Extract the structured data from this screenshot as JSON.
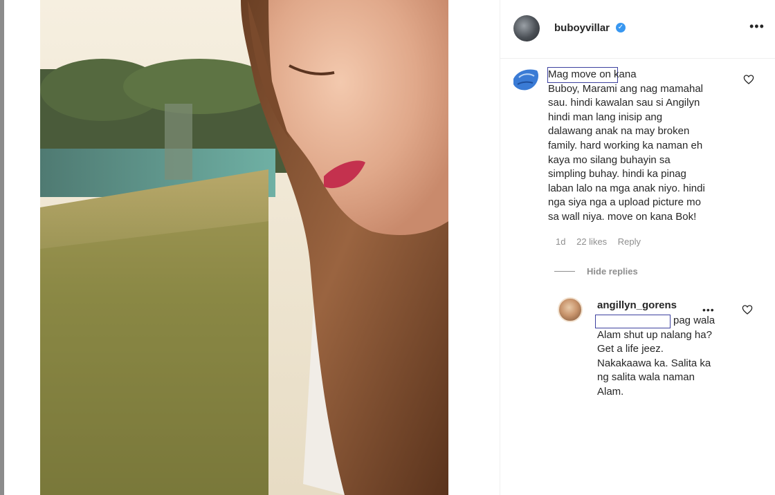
{
  "post": {
    "owner_username": "buboyvillar",
    "more_icon": "more-horizontal-icon",
    "verified_icon": "verified-badge-icon"
  },
  "comment": {
    "text": "Mag move on kana\nBuboy, Marami ang nag mamahal\nsau. hindi kawalan sau si Angilyn\nhindi man lang inisip ang\ndalawang anak na may broken\nfamily. hard working ka naman eh\nkaya mo silang buhayin sa\nsimpling buhay. hindi ka pinag\nlaban lalo na mga anak niyo. hindi\nnga siya nga a upload picture mo\nsa wall niya. move on kana Bok!",
    "time": "1d",
    "likes": "22 likes",
    "reply_label": "Reply",
    "hide_replies_label": "Hide replies"
  },
  "reply": {
    "username": "angillyn_gorens",
    "text": "pag wala\nAlam shut up nalang ha?\nGet a life jeez.\nNakakaawa ka. Salita ka\nng salita wala naman\nAlam."
  },
  "icons": {
    "like": "heart-icon",
    "reply_more": "more-horizontal-icon"
  }
}
